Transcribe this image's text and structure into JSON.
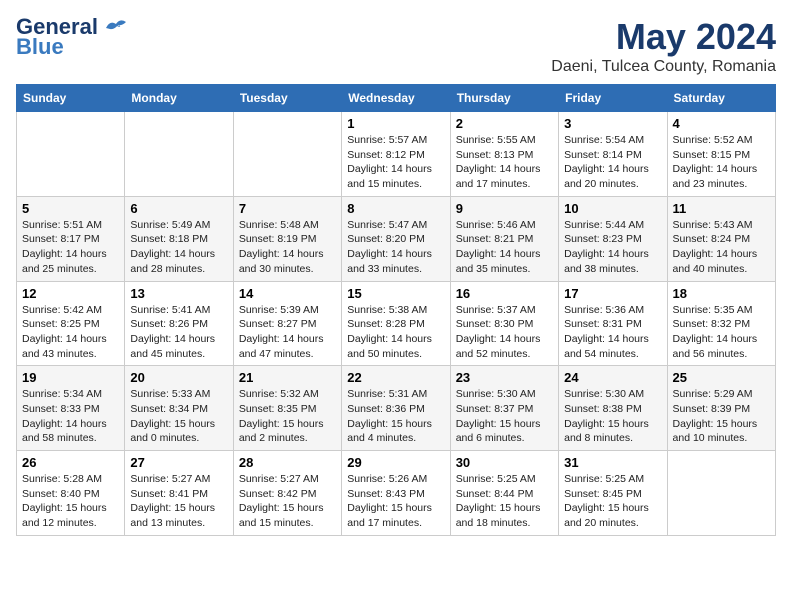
{
  "header": {
    "logo_line1": "General",
    "logo_line2": "Blue",
    "title": "May 2024",
    "subtitle": "Daeni, Tulcea County, Romania"
  },
  "weekdays": [
    "Sunday",
    "Monday",
    "Tuesday",
    "Wednesday",
    "Thursday",
    "Friday",
    "Saturday"
  ],
  "weeks": [
    [
      {
        "day": "",
        "detail": ""
      },
      {
        "day": "",
        "detail": ""
      },
      {
        "day": "",
        "detail": ""
      },
      {
        "day": "1",
        "detail": "Sunrise: 5:57 AM\nSunset: 8:12 PM\nDaylight: 14 hours\nand 15 minutes."
      },
      {
        "day": "2",
        "detail": "Sunrise: 5:55 AM\nSunset: 8:13 PM\nDaylight: 14 hours\nand 17 minutes."
      },
      {
        "day": "3",
        "detail": "Sunrise: 5:54 AM\nSunset: 8:14 PM\nDaylight: 14 hours\nand 20 minutes."
      },
      {
        "day": "4",
        "detail": "Sunrise: 5:52 AM\nSunset: 8:15 PM\nDaylight: 14 hours\nand 23 minutes."
      }
    ],
    [
      {
        "day": "5",
        "detail": "Sunrise: 5:51 AM\nSunset: 8:17 PM\nDaylight: 14 hours\nand 25 minutes."
      },
      {
        "day": "6",
        "detail": "Sunrise: 5:49 AM\nSunset: 8:18 PM\nDaylight: 14 hours\nand 28 minutes."
      },
      {
        "day": "7",
        "detail": "Sunrise: 5:48 AM\nSunset: 8:19 PM\nDaylight: 14 hours\nand 30 minutes."
      },
      {
        "day": "8",
        "detail": "Sunrise: 5:47 AM\nSunset: 8:20 PM\nDaylight: 14 hours\nand 33 minutes."
      },
      {
        "day": "9",
        "detail": "Sunrise: 5:46 AM\nSunset: 8:21 PM\nDaylight: 14 hours\nand 35 minutes."
      },
      {
        "day": "10",
        "detail": "Sunrise: 5:44 AM\nSunset: 8:23 PM\nDaylight: 14 hours\nand 38 minutes."
      },
      {
        "day": "11",
        "detail": "Sunrise: 5:43 AM\nSunset: 8:24 PM\nDaylight: 14 hours\nand 40 minutes."
      }
    ],
    [
      {
        "day": "12",
        "detail": "Sunrise: 5:42 AM\nSunset: 8:25 PM\nDaylight: 14 hours\nand 43 minutes."
      },
      {
        "day": "13",
        "detail": "Sunrise: 5:41 AM\nSunset: 8:26 PM\nDaylight: 14 hours\nand 45 minutes."
      },
      {
        "day": "14",
        "detail": "Sunrise: 5:39 AM\nSunset: 8:27 PM\nDaylight: 14 hours\nand 47 minutes."
      },
      {
        "day": "15",
        "detail": "Sunrise: 5:38 AM\nSunset: 8:28 PM\nDaylight: 14 hours\nand 50 minutes."
      },
      {
        "day": "16",
        "detail": "Sunrise: 5:37 AM\nSunset: 8:30 PM\nDaylight: 14 hours\nand 52 minutes."
      },
      {
        "day": "17",
        "detail": "Sunrise: 5:36 AM\nSunset: 8:31 PM\nDaylight: 14 hours\nand 54 minutes."
      },
      {
        "day": "18",
        "detail": "Sunrise: 5:35 AM\nSunset: 8:32 PM\nDaylight: 14 hours\nand 56 minutes."
      }
    ],
    [
      {
        "day": "19",
        "detail": "Sunrise: 5:34 AM\nSunset: 8:33 PM\nDaylight: 14 hours\nand 58 minutes."
      },
      {
        "day": "20",
        "detail": "Sunrise: 5:33 AM\nSunset: 8:34 PM\nDaylight: 15 hours\nand 0 minutes."
      },
      {
        "day": "21",
        "detail": "Sunrise: 5:32 AM\nSunset: 8:35 PM\nDaylight: 15 hours\nand 2 minutes."
      },
      {
        "day": "22",
        "detail": "Sunrise: 5:31 AM\nSunset: 8:36 PM\nDaylight: 15 hours\nand 4 minutes."
      },
      {
        "day": "23",
        "detail": "Sunrise: 5:30 AM\nSunset: 8:37 PM\nDaylight: 15 hours\nand 6 minutes."
      },
      {
        "day": "24",
        "detail": "Sunrise: 5:30 AM\nSunset: 8:38 PM\nDaylight: 15 hours\nand 8 minutes."
      },
      {
        "day": "25",
        "detail": "Sunrise: 5:29 AM\nSunset: 8:39 PM\nDaylight: 15 hours\nand 10 minutes."
      }
    ],
    [
      {
        "day": "26",
        "detail": "Sunrise: 5:28 AM\nSunset: 8:40 PM\nDaylight: 15 hours\nand 12 minutes."
      },
      {
        "day": "27",
        "detail": "Sunrise: 5:27 AM\nSunset: 8:41 PM\nDaylight: 15 hours\nand 13 minutes."
      },
      {
        "day": "28",
        "detail": "Sunrise: 5:27 AM\nSunset: 8:42 PM\nDaylight: 15 hours\nand 15 minutes."
      },
      {
        "day": "29",
        "detail": "Sunrise: 5:26 AM\nSunset: 8:43 PM\nDaylight: 15 hours\nand 17 minutes."
      },
      {
        "day": "30",
        "detail": "Sunrise: 5:25 AM\nSunset: 8:44 PM\nDaylight: 15 hours\nand 18 minutes."
      },
      {
        "day": "31",
        "detail": "Sunrise: 5:25 AM\nSunset: 8:45 PM\nDaylight: 15 hours\nand 20 minutes."
      },
      {
        "day": "",
        "detail": ""
      }
    ]
  ]
}
